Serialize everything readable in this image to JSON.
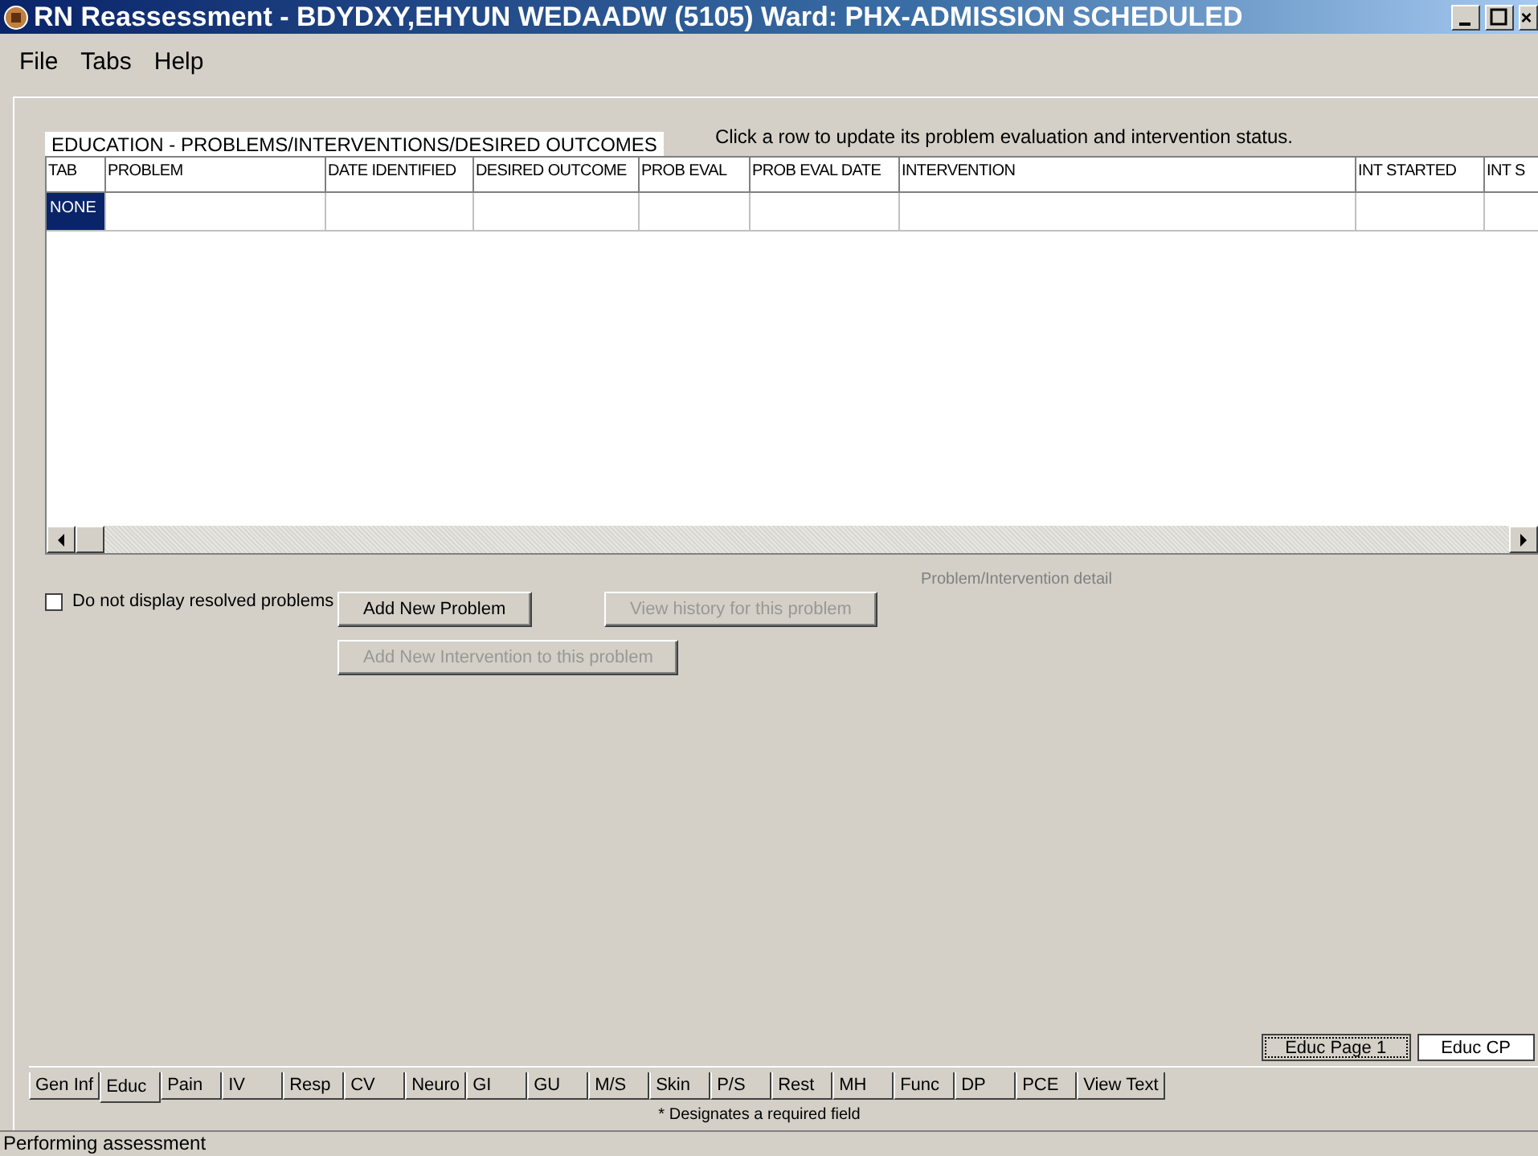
{
  "window": {
    "title": "RN Reassessment - BDYDXY,EHYUN WEDAADW  (5105)  Ward: PHX-ADMISSION SCHEDULED"
  },
  "menu": [
    {
      "label": "File"
    },
    {
      "label": "Tabs"
    },
    {
      "label": "Help"
    }
  ],
  "section_title": "EDUCATION - PROBLEMS/INTERVENTIONS/DESIRED OUTCOMES",
  "hint": "Click a row to update its problem evaluation and intervention status.",
  "table": {
    "columns": [
      "TAB",
      "PROBLEM",
      "DATE IDENTIFIED",
      "DESIRED OUTCOME",
      "PROB EVAL",
      "PROB EVAL DATE",
      "INTERVENTION",
      "INT STARTED",
      "INT S"
    ],
    "rows": [
      {
        "tab": "NONE",
        "selected": true
      }
    ]
  },
  "detail_label": "Problem/Intervention detail",
  "hide_resolved": {
    "label": "Do not display resolved problems",
    "checked": false
  },
  "buttons": [
    {
      "label": "Add New Problem",
      "disabled": false
    },
    {
      "label": "View history for this problem",
      "disabled": true
    },
    {
      "label": "Add New Intervention to this problem",
      "disabled": true
    }
  ],
  "page_tabs": [
    {
      "label": "Educ Page 1",
      "selected": true
    },
    {
      "label": "Educ CP",
      "selected": false
    }
  ],
  "tabs": [
    {
      "label": "Gen Inf",
      "selected": false
    },
    {
      "label": "Educ",
      "selected": true
    },
    {
      "label": "Pain",
      "selected": false
    },
    {
      "label": "IV",
      "selected": false
    },
    {
      "label": "Resp",
      "selected": false
    },
    {
      "label": "CV",
      "selected": false
    },
    {
      "label": "Neuro",
      "selected": false
    },
    {
      "label": "GI",
      "selected": false
    },
    {
      "label": "GU",
      "selected": false
    },
    {
      "label": "M/S",
      "selected": false
    },
    {
      "label": "Skin",
      "selected": false
    },
    {
      "label": "P/S",
      "selected": false
    },
    {
      "label": "Rest",
      "selected": false
    },
    {
      "label": "MH",
      "selected": false
    },
    {
      "label": "Func",
      "selected": false
    },
    {
      "label": "DP",
      "selected": false
    },
    {
      "label": "PCE",
      "selected": false
    },
    {
      "label": "View Text",
      "selected": false
    }
  ],
  "required_note": "* Designates a required field",
  "status_bar": "Performing assessment"
}
